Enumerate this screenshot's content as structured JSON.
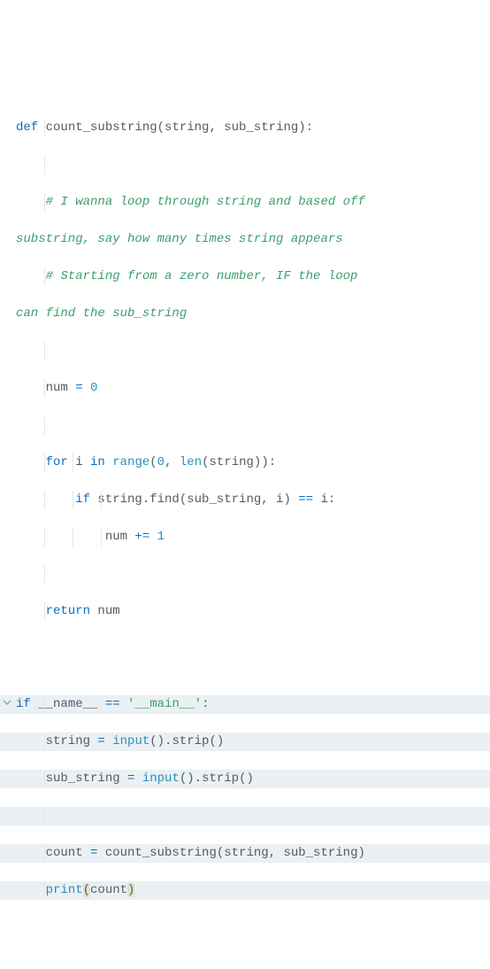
{
  "code": {
    "l1_def": "def",
    "l1_fn": " count_substring",
    "l1_rest": "(string, sub_string):",
    "l2": "",
    "l3": "    # I wanna loop through string and based off ",
    "l3b": "substring, say how many times string appears",
    "l4": "    # Starting from a zero number, IF the loop ",
    "l4b": "can find the sub_string",
    "l5": "",
    "l6_a": "    num ",
    "l6_op": "=",
    "l6_b": " ",
    "l6_num": "0",
    "l7": "",
    "l8_for": "    for",
    "l8_a": " i ",
    "l8_in": "in",
    "l8_b": " ",
    "l8_range": "range",
    "l8_c": "(",
    "l8_zero": "0",
    "l8_d": ", ",
    "l8_len": "len",
    "l8_e": "(string)):",
    "l9_if": "        if",
    "l9_a": " string.find(sub_string, i) ",
    "l9_eq": "==",
    "l9_b": " i:",
    "l10_a": "            num ",
    "l10_op": "+=",
    "l10_b": " ",
    "l10_num": "1",
    "l11": "",
    "l12_ret": "    return",
    "l12_a": " num",
    "l13": "",
    "l14_if": "if",
    "l14_a": " __name__ ",
    "l14_eq": "==",
    "l14_b": " ",
    "l14_str": "'__main__'",
    "l14_c": ":",
    "l15_a": "    string ",
    "l15_op": "=",
    "l15_b": " ",
    "l15_fn": "input",
    "l15_c": "().strip()",
    "l16_a": "    sub_string ",
    "l16_op": "=",
    "l16_b": " ",
    "l16_fn": "input",
    "l16_c": "().strip()",
    "l17": "",
    "l18_a": "    count ",
    "l18_op": "=",
    "l18_b": " count_substring(string, sub_string)",
    "l19_a": "    ",
    "l19_fn": "print",
    "l19_p1": "(",
    "l19_b": "count",
    "l19_p2": ")"
  }
}
